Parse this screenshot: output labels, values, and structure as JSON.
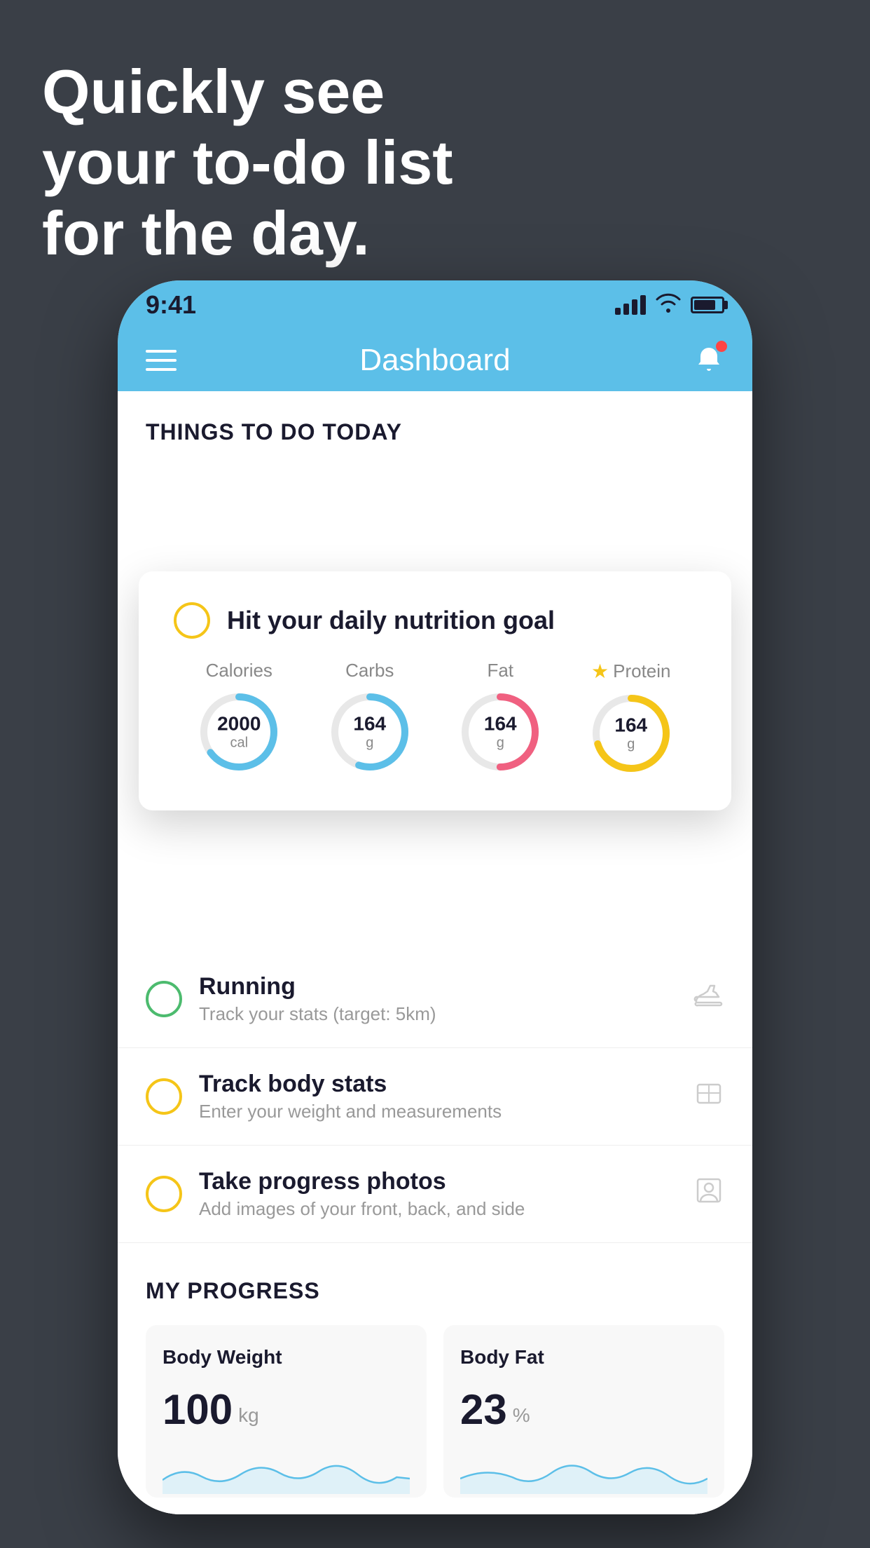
{
  "background": {
    "color": "#3a3f47"
  },
  "headline": {
    "line1": "Quickly see",
    "line2": "your to-do list",
    "line3": "for the day."
  },
  "phone": {
    "status_bar": {
      "time": "9:41"
    },
    "nav_bar": {
      "title": "Dashboard",
      "hamburger_label": "menu",
      "bell_label": "notifications"
    },
    "things_today_header": "THINGS TO DO TODAY",
    "floating_card": {
      "task_label": "Hit your daily nutrition goal",
      "circle_color": "#f5c518",
      "nutrition": [
        {
          "label": "Calories",
          "value": "2000",
          "unit": "cal",
          "color": "#5cbfe8",
          "percent": 65,
          "starred": false
        },
        {
          "label": "Carbs",
          "value": "164",
          "unit": "g",
          "color": "#5cbfe8",
          "percent": 55,
          "starred": false
        },
        {
          "label": "Fat",
          "value": "164",
          "unit": "g",
          "color": "#f06080",
          "percent": 50,
          "starred": false
        },
        {
          "label": "Protein",
          "value": "164",
          "unit": "g",
          "color": "#f5c518",
          "percent": 70,
          "starred": true
        }
      ]
    },
    "task_list": [
      {
        "title": "Running",
        "subtitle": "Track your stats (target: 5km)",
        "circle_type": "green",
        "icon": "shoe"
      },
      {
        "title": "Track body stats",
        "subtitle": "Enter your weight and measurements",
        "circle_type": "yellow",
        "icon": "scale"
      },
      {
        "title": "Take progress photos",
        "subtitle": "Add images of your front, back, and side",
        "circle_type": "yellow",
        "icon": "person"
      }
    ],
    "progress": {
      "header": "MY PROGRESS",
      "cards": [
        {
          "title": "Body Weight",
          "value": "100",
          "unit": "kg"
        },
        {
          "title": "Body Fat",
          "value": "23",
          "unit": "%"
        }
      ]
    }
  }
}
